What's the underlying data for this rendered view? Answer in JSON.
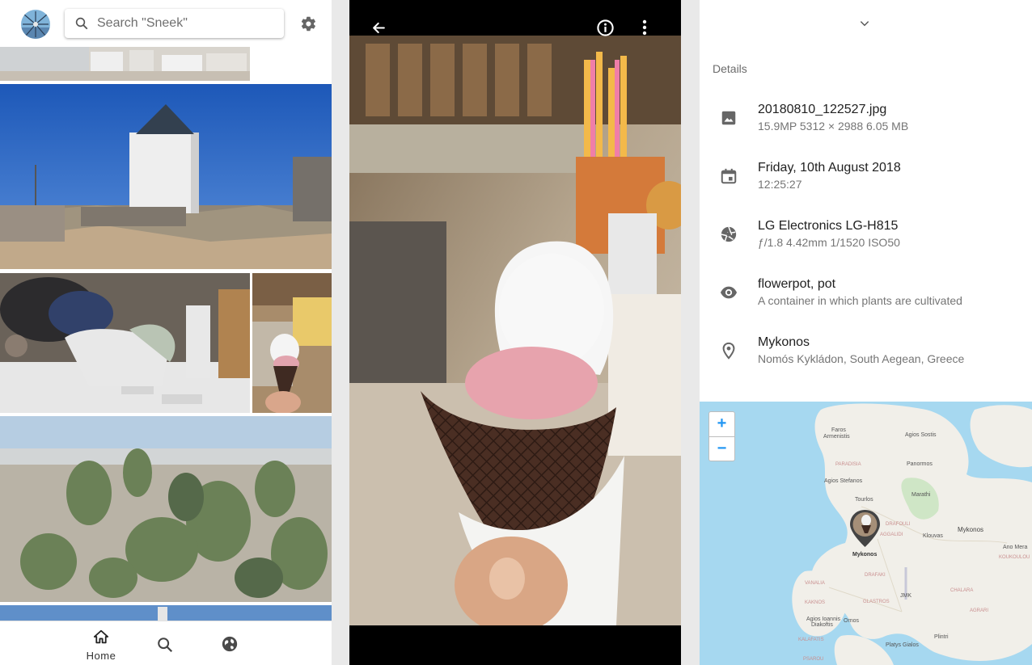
{
  "search": {
    "placeholder": "Search \"Sneek\""
  },
  "icons": {
    "avatar": "windmill-avatar",
    "search": "magnifier",
    "settings": "gear",
    "back": "arrow-left",
    "info": "info-circle",
    "more": "vertical-dots",
    "collapse": "chevron-down",
    "image": "image",
    "date": "calendar",
    "camera": "aperture",
    "tags": "eye",
    "location": "map-pin"
  },
  "gallery": [
    {
      "name": "windmill-photo"
    },
    {
      "name": "goat-sculpture-photo"
    },
    {
      "name": "ice-cream-thumbnail"
    },
    {
      "name": "cactus-photo"
    }
  ],
  "bottom_nav": {
    "home_label": "Home"
  },
  "details": {
    "heading": "Details",
    "file": {
      "name": "20180810_122527.jpg",
      "meta": "15.9MP   5312 × 2988   6.05 MB"
    },
    "date": {
      "primary": "Friday, 10th August 2018",
      "secondary": "12:25:27"
    },
    "camera": {
      "primary": "LG Electronics LG-H815",
      "secondary": "ƒ/1.8    4.42mm    1/1520    ISO50"
    },
    "tags": {
      "primary": "flowerpot, pot",
      "secondary": "A container in which plants are cultivated"
    },
    "location": {
      "primary": "Mykonos",
      "secondary": "Nomós Kykládon, South Aegean, Greece"
    }
  },
  "map": {
    "zoom_in": "+",
    "zoom_out": "−",
    "labels": {
      "faros": "Faros",
      "armenistis": "Armenistis",
      "agios_sostis": "Agios Sostis",
      "paradisia": "PARADISIA",
      "panormos": "Panormos",
      "agios_stefanos": "Agios Stefanos",
      "marathi": "Marathi",
      "tourlos": "Tourlos",
      "drafouli": "DRAFOULI",
      "mykonos_region": "Mykonos",
      "aglidi": "AGGALIDI",
      "klouvas": "Klouvas",
      "ano_mera": "Ano Mera",
      "koukoulou": "KOUKOULOU",
      "mykonos_town": "Mykonos",
      "vanalia": "VANALIA",
      "drafaki": "DRAFAKI",
      "kaknos": "KAKNOS",
      "mykonos_airport": "JMK",
      "chalara": "CHALARA",
      "agios_ioannis": "Agios Ioannis",
      "diakoftis": "Diakoftis",
      "glastros": "GLASTROS",
      "agrari": "AGRARI",
      "ornos": "Ornos",
      "plintri": "Plintri",
      "platys_gialos": "Platys Gialos",
      "kalafatis": "KALAFATIS",
      "psarou": "PSAROU"
    }
  }
}
